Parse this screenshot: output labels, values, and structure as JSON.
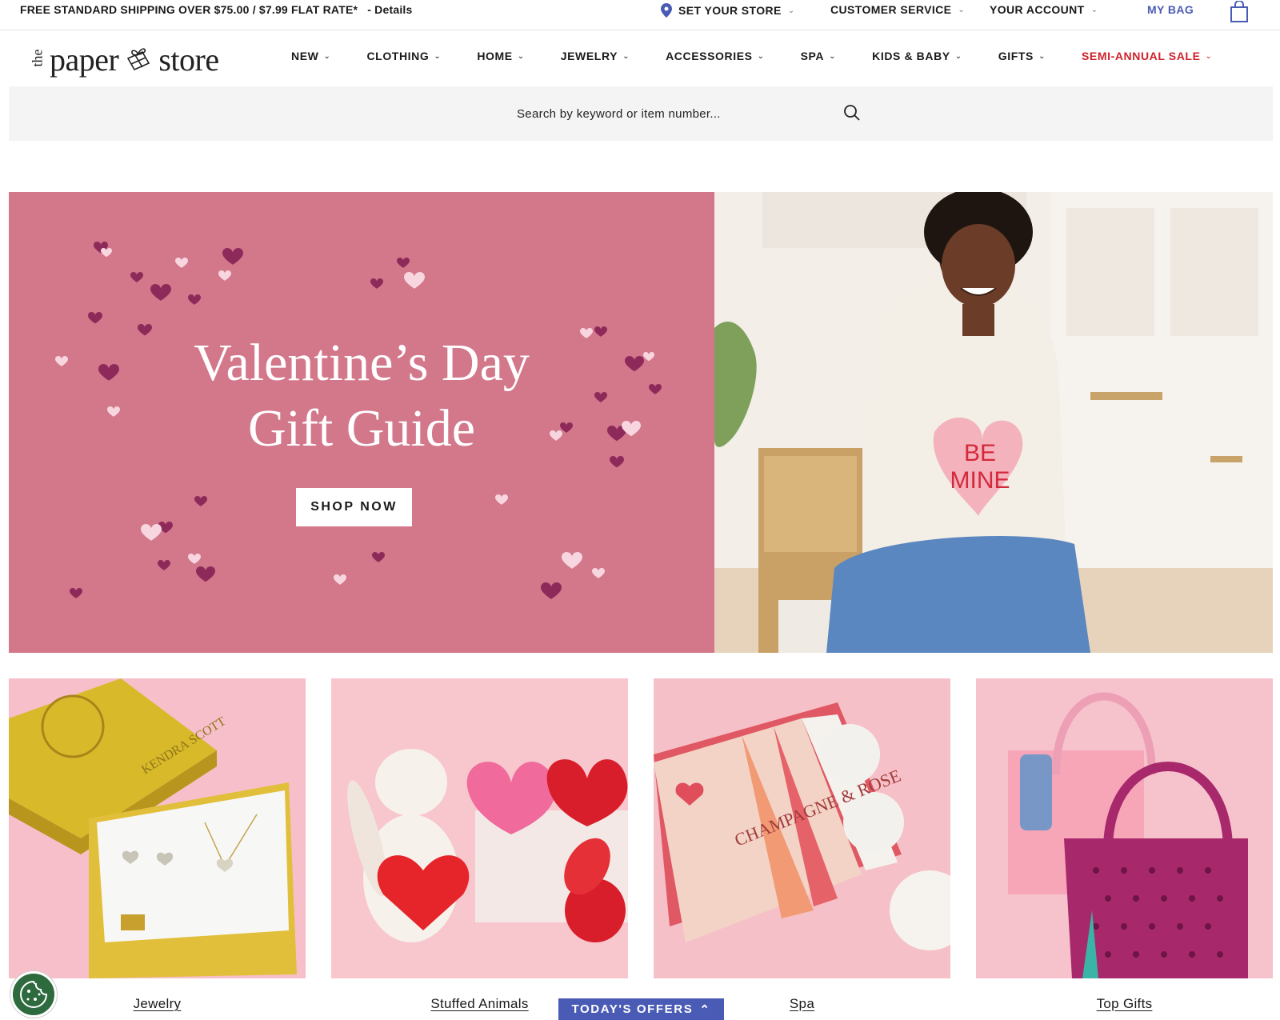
{
  "topbar": {
    "promo": "FREE STANDARD SHIPPING OVER $75.00 / $7.99 FLAT RATE*",
    "details": "- Details",
    "store": "SET YOUR STORE",
    "customer_service": "CUSTOMER SERVICE",
    "account": "YOUR ACCOUNT",
    "bag": "MY BAG"
  },
  "logo": {
    "the": "the",
    "paper": "paper",
    "store": "store"
  },
  "nav": {
    "items": [
      {
        "label": "NEW"
      },
      {
        "label": "CLOTHING"
      },
      {
        "label": "HOME"
      },
      {
        "label": "JEWELRY"
      },
      {
        "label": "ACCESSORIES"
      },
      {
        "label": "SPA"
      },
      {
        "label": "KIDS & BABY"
      },
      {
        "label": "GIFTS"
      },
      {
        "label": "SEMI-ANNUAL SALE"
      }
    ]
  },
  "search": {
    "placeholder": "Search by keyword or item number..."
  },
  "hero": {
    "title_line1": "Valentine’s Day",
    "title_line2": "Gift Guide",
    "cta": "SHOP NOW",
    "sweater_text": "BE MINE"
  },
  "categories": [
    {
      "label": "Jewelry",
      "box_text": "KENDRA SCOTT"
    },
    {
      "label": "Stuffed Animals"
    },
    {
      "label": "Spa",
      "product_text": "CHAMPAGNE & ROSE"
    },
    {
      "label": "Top Gifts"
    }
  ],
  "offers": {
    "label": "TODAY'S OFFERS"
  },
  "colors": {
    "accent": "#4a5bb5",
    "sale": "#d0202a",
    "hero_pink": "#d3778a"
  }
}
